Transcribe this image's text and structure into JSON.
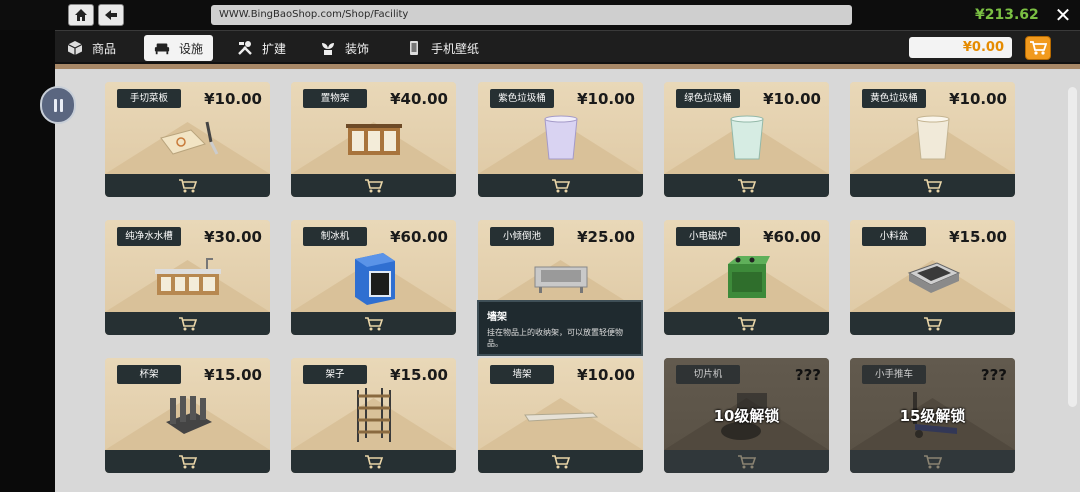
{
  "browser": {
    "url": "WWW.BingBaoShop.com/Shop/Facility",
    "balance": "¥213.62"
  },
  "nav": {
    "tabs": [
      {
        "label": "商品",
        "icon": "box-icon"
      },
      {
        "label": "设施",
        "icon": "sofa-icon"
      },
      {
        "label": "扩建",
        "icon": "tools-icon"
      },
      {
        "label": "装饰",
        "icon": "plant-icon"
      },
      {
        "label": "手机壁纸",
        "icon": "phone-icon"
      }
    ],
    "active_tab": "设施",
    "cart_total": "¥0.00"
  },
  "items": [
    {
      "name": "手切菜板",
      "price": "¥10.00",
      "icon": "cutting-board-icon",
      "locked": false
    },
    {
      "name": "置物架",
      "price": "¥40.00",
      "icon": "cabinet-icon",
      "locked": false
    },
    {
      "name": "紫色垃圾桶",
      "price": "¥10.00",
      "icon": "trash-bin-icon",
      "locked": false
    },
    {
      "name": "绿色垃圾桶",
      "price": "¥10.00",
      "icon": "trash-bin-icon",
      "locked": false
    },
    {
      "name": "黄色垃圾桶",
      "price": "¥10.00",
      "icon": "trash-bin-icon",
      "locked": false
    },
    {
      "name": "纯净水水槽",
      "price": "¥30.00",
      "icon": "sink-counter-icon",
      "locked": false
    },
    {
      "name": "制冰机",
      "price": "¥60.00",
      "icon": "ice-machine-icon",
      "locked": false
    },
    {
      "name": "小倾倒池",
      "price": "¥25.00",
      "icon": "small-sink-icon",
      "locked": false
    },
    {
      "name": "小电磁炉",
      "price": "¥60.00",
      "icon": "stove-icon",
      "locked": false
    },
    {
      "name": "小料盆",
      "price": "¥15.00",
      "icon": "tray-icon",
      "locked": false
    },
    {
      "name": "杯架",
      "price": "¥15.00",
      "icon": "cup-rack-icon",
      "locked": false
    },
    {
      "name": "架子",
      "price": "¥15.00",
      "icon": "shelf-icon",
      "locked": false
    },
    {
      "name": "墙架",
      "price": "¥10.00",
      "icon": "wall-shelf-icon",
      "locked": false
    },
    {
      "name": "切片机",
      "price": "???",
      "icon": "slicer-icon",
      "locked": true,
      "lock_text": "10级解锁"
    },
    {
      "name": "小手推车",
      "price": "???",
      "icon": "hand-truck-icon",
      "locked": true,
      "lock_text": "15级解锁"
    }
  ],
  "tooltip": {
    "title": "墙架",
    "desc": "挂在物品上的收纳架，可以放置轻便物品。"
  },
  "colors": {
    "accent_orange": "#f19a1e",
    "balance_green": "#7bc043",
    "card_dark": "#263033",
    "card_tan": "#e5d2b0"
  }
}
